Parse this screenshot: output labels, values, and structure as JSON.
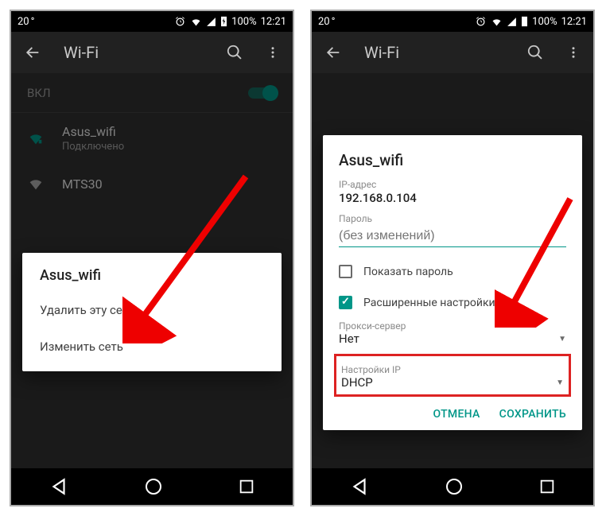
{
  "status": {
    "temp": "20",
    "deg": "°",
    "battery": "100%",
    "time": "12:21"
  },
  "appbar": {
    "title": "Wi-Fi"
  },
  "toggle": {
    "label": "ВКЛ"
  },
  "networks": [
    {
      "name": "Asus_wifi",
      "sub": "Подключено"
    },
    {
      "name": "MTS30",
      "sub": ""
    }
  ],
  "ctx": {
    "title": "Asus_wifi",
    "items": [
      "Удалить эту сеть",
      "Изменить сеть"
    ]
  },
  "dialog": {
    "title": "Asus_wifi",
    "ip_label": "IP-адрес",
    "ip_value": "192.168.0.104",
    "pw_label": "Пароль",
    "pw_placeholder": "(без изменений)",
    "show_pw": "Показать пароль",
    "advanced": "Расширенные настройки",
    "proxy_label": "Прокси-сервер",
    "proxy_value": "Нет",
    "ip_settings_label": "Настройки IP",
    "ip_settings_value": "DHCP",
    "cancel": "ОТМЕНА",
    "save": "СОХРАНИТЬ"
  }
}
